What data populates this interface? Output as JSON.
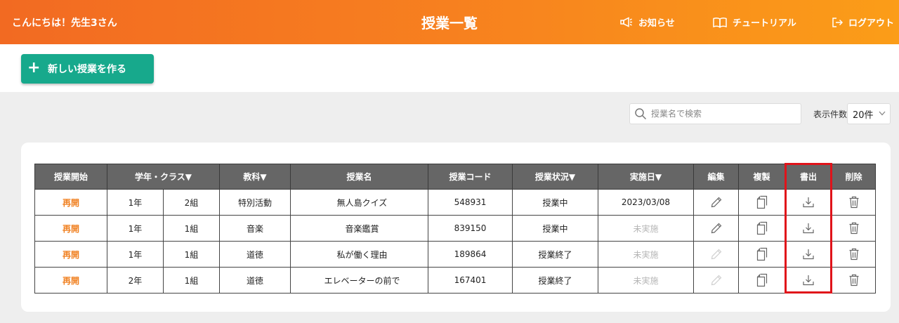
{
  "header": {
    "greeting": "こんにちは！先生3さん",
    "title": "授業一覧",
    "notice_label": "お知らせ",
    "tutorial_label": "チュートリアル",
    "logout_label": "ログアウト"
  },
  "toolbar": {
    "new_lesson_label": "新しい授業を作る",
    "search_placeholder": "授業名で検索",
    "per_page_label": "表示件数",
    "per_page_value": "20件"
  },
  "table": {
    "headers": {
      "start": "授業開始",
      "grade_class": "学年・クラス▼",
      "subject": "教科▼",
      "name": "授業名",
      "code": "授業コード",
      "status": "授業状況▼",
      "date": "実施日▼",
      "edit": "編集",
      "copy": "複製",
      "export": "書出",
      "delete": "削除"
    },
    "rows": [
      {
        "start": "再開",
        "grade": "1年",
        "class": "2組",
        "subject": "特別活動",
        "name": "無人島クイズ",
        "code": "548931",
        "status": "授業中",
        "date": "2023/03/08"
      },
      {
        "start": "再開",
        "grade": "1年",
        "class": "1組",
        "subject": "音楽",
        "name": "音楽鑑賞",
        "code": "839150",
        "status": "授業中",
        "date": "未実施"
      },
      {
        "start": "再開",
        "grade": "1年",
        "class": "1組",
        "subject": "道徳",
        "name": "私が働く理由",
        "code": "189864",
        "status": "授業終了",
        "date": "未実施"
      },
      {
        "start": "再開",
        "grade": "2年",
        "class": "1組",
        "subject": "道徳",
        "name": "エレベーターの前で",
        "code": "167401",
        "status": "授業終了",
        "date": "未実施"
      }
    ]
  },
  "colors": {
    "header_start": "#f26a22",
    "header_end": "#fb9d18",
    "primary_button": "#17a98c",
    "reopen_text": "#f08020",
    "status_active_bg": "#fdf5c9",
    "status_done_bg": "#fbdbe9",
    "highlight_border": "#e0131a"
  },
  "icons": [
    "megaphone-icon",
    "book-icon",
    "logout-icon",
    "plus-icon",
    "search-icon",
    "chevron-down-icon",
    "pencil-icon",
    "copy-icon",
    "download-icon",
    "trash-icon"
  ]
}
